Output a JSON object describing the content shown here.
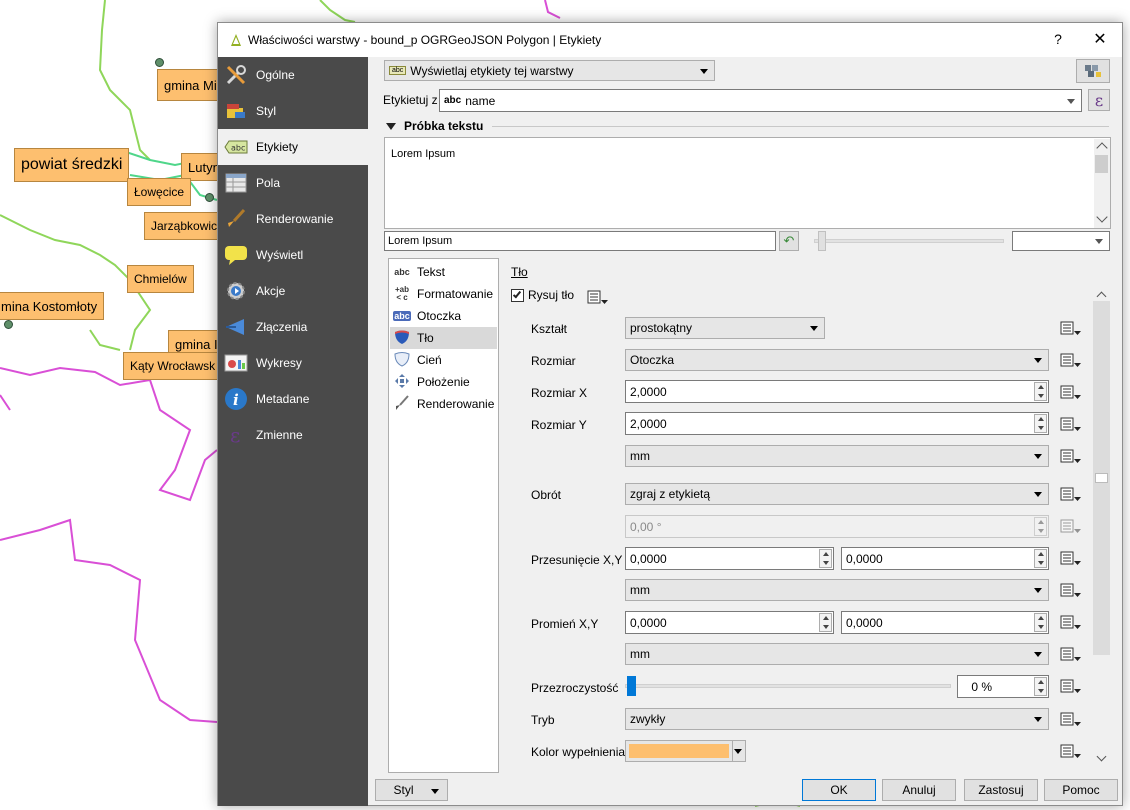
{
  "window": {
    "title": "Właściwości warstwy - bound_p OGRGeoJSON Polygon | Etykiety",
    "help": "?",
    "close": "✕"
  },
  "map": {
    "labels": [
      "gmina Mi",
      "powiat średzki",
      "Lutyn",
      "Łowęcice",
      "Jarząbkowic",
      "Chmielów",
      "mina Kostomłoty",
      "gmina I",
      "Kąty Wrocławsk"
    ]
  },
  "sidebar": {
    "items": [
      {
        "label": "Ogólne",
        "icon": "tools-icon"
      },
      {
        "label": "Styl",
        "icon": "paint-icon"
      },
      {
        "label": "Etykiety",
        "icon": "labels-icon"
      },
      {
        "label": "Pola",
        "icon": "table-icon"
      },
      {
        "label": "Renderowanie",
        "icon": "brush-icon"
      },
      {
        "label": "Wyświetl",
        "icon": "tooltip-icon"
      },
      {
        "label": "Akcje",
        "icon": "gear-play-icon"
      },
      {
        "label": "Złączenia",
        "icon": "join-icon"
      },
      {
        "label": "Wykresy",
        "icon": "chart-icon"
      },
      {
        "label": "Metadane",
        "icon": "info-icon"
      },
      {
        "label": "Zmienne",
        "icon": "epsilon-icon"
      }
    ]
  },
  "labeling": {
    "mode": "Wyświetlaj etykiety tej warstwy",
    "mode_badge": "abc",
    "label_with": "Etykietuj z",
    "field_badge": "abc",
    "field": "name",
    "expression_icon": "ε"
  },
  "sample": {
    "header": "Próbka tekstu",
    "text": "Lorem Ipsum",
    "input": "Lorem Ipsum"
  },
  "tabs": [
    {
      "label": "Tekst",
      "icon": "abc"
    },
    {
      "label": "Formatowanie",
      "icon": "+ab"
    },
    {
      "label": "Otoczka",
      "icon": "abc"
    },
    {
      "label": "Tło",
      "icon": "shield"
    },
    {
      "label": "Cień",
      "icon": "shadow"
    },
    {
      "label": "Położenie",
      "icon": "arrows"
    },
    {
      "label": "Renderowanie",
      "icon": "brush"
    }
  ],
  "background": {
    "section_title": "Tło",
    "draw_checkbox": "Rysuj tło",
    "draw_checked": true,
    "shape_label": "Kształt",
    "shape_value": "prostokątny",
    "size_label": "Rozmiar",
    "size_value": "Otoczka",
    "size_x_label": "Rozmiar X",
    "size_x_value": "2,0000",
    "size_y_label": "Rozmiar Y",
    "size_y_value": "2,0000",
    "size_unit": "mm",
    "rotation_label": "Obrót",
    "rotation_value": "zgraj z etykietą",
    "rotation_angle": "0,00 °",
    "offset_label": "Przesunięcie X,Y",
    "offset_x": "0,0000",
    "offset_y": "0,0000",
    "offset_unit": "mm",
    "radius_label": "Promień X,Y",
    "radius_x": "0,0000",
    "radius_y": "0,0000",
    "radius_unit": "mm",
    "opacity_label": "Przezroczystość",
    "opacity_value": "0 %",
    "blend_label": "Tryb",
    "blend_value": "zwykły",
    "fill_label": "Kolor wypełnienia",
    "fill_color": "#fdbf6f"
  },
  "footer": {
    "style": "Styl",
    "ok": "OK",
    "cancel": "Anuluj",
    "apply": "Zastosuj",
    "help": "Pomoc"
  },
  "colors": {
    "sidebar_bg": "#4a4a4a",
    "dialog_bg": "#f0f0f0",
    "label_fill": "#fdbf6f",
    "boundary_green": "#4fd68a",
    "boundary_magenta": "#d94fd6"
  }
}
